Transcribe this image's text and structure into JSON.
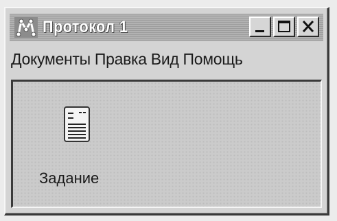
{
  "window": {
    "title": "Протокол 1",
    "app_icon": "network-app-icon",
    "controls": {
      "minimize_icon": "minimize-icon",
      "maximize_icon": "maximize-icon",
      "close_icon": "close-icon"
    }
  },
  "menu": {
    "items": [
      {
        "label": "Документы"
      },
      {
        "label": "Правка"
      },
      {
        "label": "Вид"
      },
      {
        "label": "Помощь"
      }
    ]
  },
  "workspace": {
    "icons": [
      {
        "label": "Задание",
        "icon": "document-icon"
      }
    ]
  }
}
